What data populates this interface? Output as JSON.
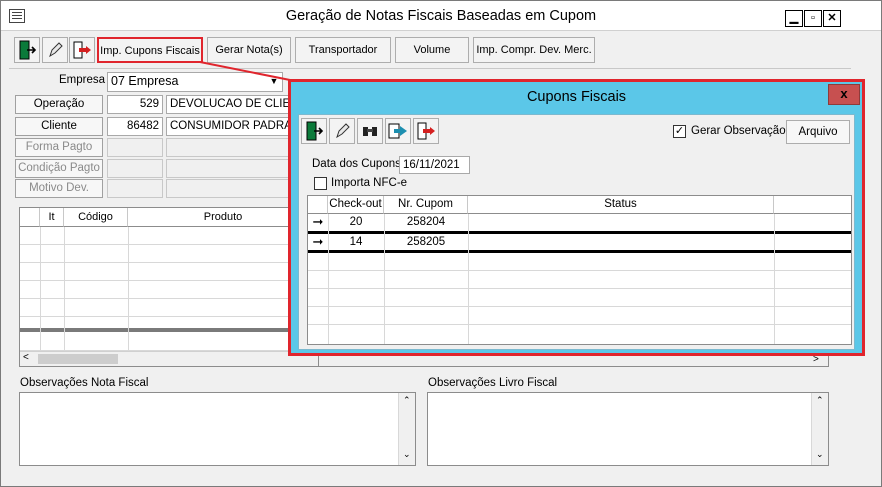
{
  "window": {
    "title": "Geração de Notas Fiscais Baseadas em Cupom"
  },
  "toolbar": {
    "icons": [
      "exit-door-icon",
      "pencil-icon",
      "exit-arrow-icon"
    ],
    "buttons": [
      "Imp. Cupons Fiscais",
      "Gerar Nota(s)",
      "Transportador",
      "Volume",
      "Imp. Compr. Dev. Merc."
    ],
    "highlighted": "Imp. Cupons Fiscais"
  },
  "form": {
    "empresa_label": "Empresa",
    "empresa_value": "07 Empresa",
    "operacao_label": "Operação",
    "operacao_code": "529",
    "operacao_desc": "DEVOLUCAO DE CLIENTE",
    "cliente_label": "Cliente",
    "cliente_code": "86482",
    "cliente_desc": "CONSUMIDOR PADRAO",
    "forma_pagto_label": "Forma Pagto",
    "condicao_pagto_label": "Condição Pagto",
    "motivo_dev_label": "Motivo Dev."
  },
  "items_grid": {
    "columns": [
      "It",
      "Código",
      "Produto"
    ]
  },
  "observacoes": {
    "nota_fiscal_label": "Observações Nota Fiscal",
    "livro_fiscal_label": "Observações Livro Fiscal"
  },
  "dialog": {
    "title": "Cupons Fiscais",
    "close": "x",
    "gerar_observacao_label": "Gerar Observação",
    "gerar_observacao_checked": true,
    "arquivo_label": "Arquivo",
    "data_label": "Data dos Cupons",
    "data_value": "16/11/2021",
    "importa_nfce_label": "Importa NFC-e",
    "importa_nfce_checked": false,
    "grid": {
      "columns": [
        "Check-out",
        "Nr. Cupom",
        "Status"
      ],
      "rows": [
        {
          "checkout": "20",
          "cupom": "258204",
          "status": ""
        },
        {
          "checkout": "14",
          "cupom": "258205",
          "status": ""
        }
      ]
    }
  },
  "colors": {
    "highlight": "#e0252d",
    "dialog_frame": "#5bc7e8"
  }
}
